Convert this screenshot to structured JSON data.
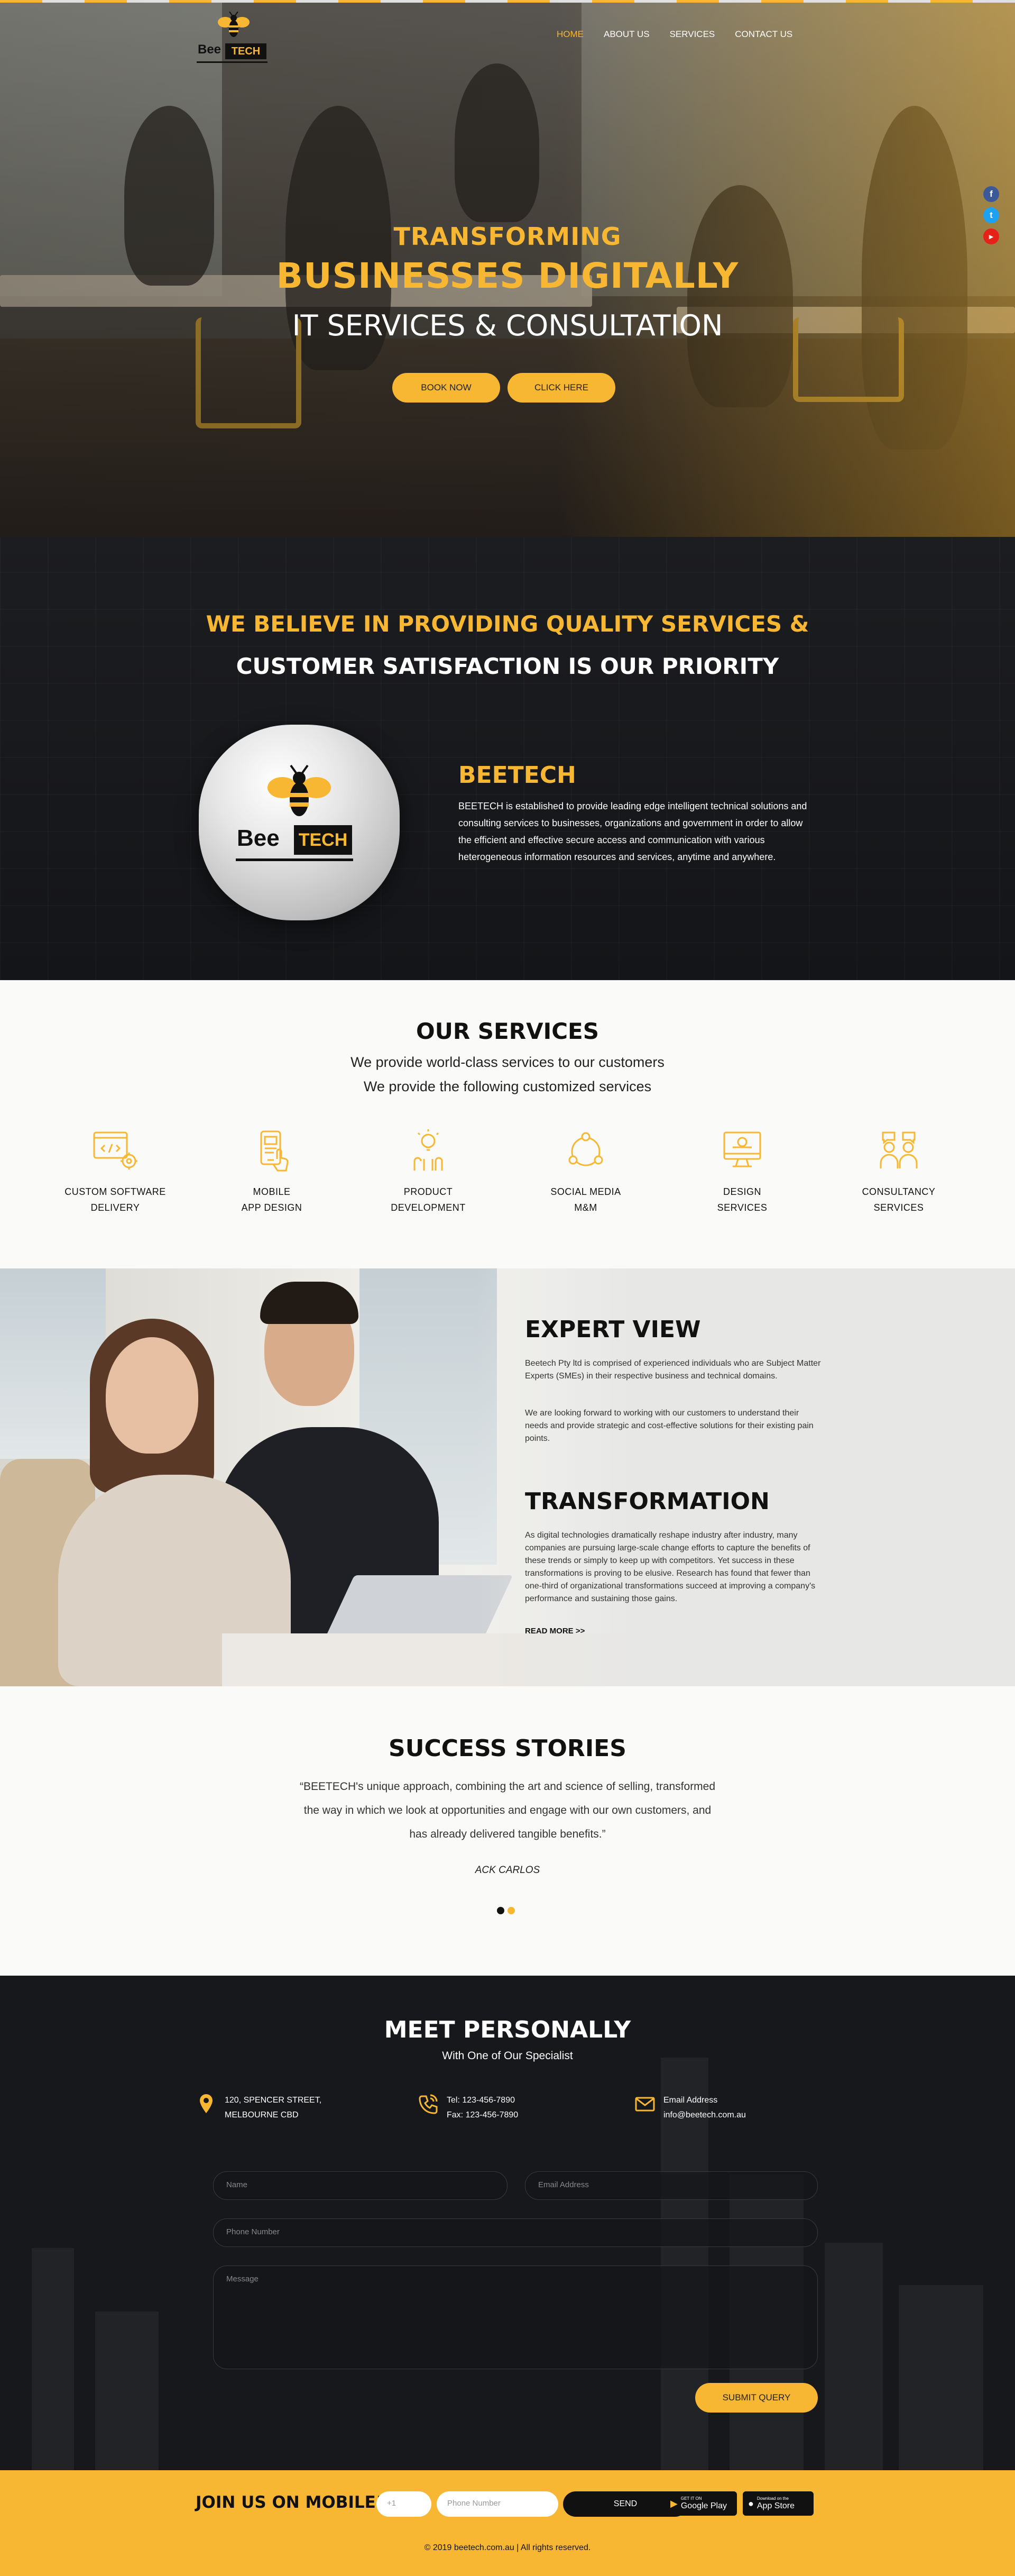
{
  "brand": {
    "name_left": "Bee",
    "name_right": "TECH"
  },
  "nav": {
    "items": [
      {
        "label": "HOME",
        "active": true
      },
      {
        "label": "ABOUT US",
        "active": false
      },
      {
        "label": "SERVICES",
        "active": false
      },
      {
        "label": "CONTACT US",
        "active": false
      }
    ]
  },
  "social": [
    {
      "icon": "facebook-icon",
      "glyph": "f",
      "color": "#3b5998"
    },
    {
      "icon": "twitter-icon",
      "glyph": "t",
      "color": "#1da1f2"
    },
    {
      "icon": "youtube-icon",
      "glyph": "▶",
      "color": "#e62117"
    }
  ],
  "hero": {
    "line1": "TRANSFORMING",
    "line2": "BUSINESSES DIGITALLY",
    "line3": "IT SERVICES & CONSULTATION",
    "button_book": "BOOK NOW",
    "button_click": "CLICK HERE"
  },
  "believe": {
    "heading1": "WE BELIEVE IN PROVIDING QUALITY SERVICES &",
    "heading2": "CUSTOMER SATISFACTION IS OUR PRIORITY",
    "about_title": "BEETECH",
    "about_text": "BEETECH is established to provide leading edge intelligent technical solutions and consulting services to businesses, organizations and government in order to allow the efficient and effective secure access and communication with various heterogeneous information resources and services, anytime and anywhere."
  },
  "services": {
    "title": "OUR SERVICES",
    "subtitle1": "We provide world-class services to our customers",
    "subtitle2": "We provide the following customized services",
    "items": [
      {
        "line1": "CUSTOM SOFTWARE",
        "line2": "DELIVERY",
        "icon": "software-gear-icon"
      },
      {
        "line1": "MOBILE",
        "line2": "APP DESIGN",
        "icon": "mobile-touch-icon"
      },
      {
        "line1": "PRODUCT",
        "line2": "DEVELOPMENT",
        "icon": "product-bulb-icon"
      },
      {
        "line1": "SOCIAL MEDIA",
        "line2": "M&M",
        "icon": "social-network-icon"
      },
      {
        "line1": "DESIGN",
        "line2": "SERVICES",
        "icon": "design-monitor-icon"
      },
      {
        "line1": "CONSULTANCY",
        "line2": "SERVICES",
        "icon": "consultancy-people-icon"
      }
    ]
  },
  "expert": {
    "title": "EXPERT VIEW",
    "para1": "Beetech Pty ltd is comprised of experienced individuals who are Subject Matter Experts (SMEs) in their respective business and technical domains.",
    "para2": "We are looking forward to working with our customers to understand their needs and provide strategic and cost-effective solutions for their existing pain points.",
    "title2": "TRANSFORMATION",
    "para3": "As digital technologies dramatically reshape industry after industry, many companies are pursuing large-scale change efforts to capture the benefits of these trends or simply to keep up with competitors. Yet success in these transformations is proving to be elusive. Research has found that fewer than one-third of organizational transformations succeed at improving a company's performance and sustaining those gains.",
    "read_more": "READ MORE >>"
  },
  "success": {
    "title": "SUCCESS STORIES",
    "quote": "“BEETECH's unique approach, combining the art and science of selling, transformed the way in which we look at opportunities and engage with our own customers, and has already delivered tangible benefits.”",
    "author": "ACK CARLOS",
    "dot_colors": [
      "#111111",
      "#f7b733"
    ]
  },
  "contact": {
    "title": "MEET PERSONALLY",
    "subtitle": "With One of Our Specialist",
    "address1": "120, SPENCER STREET,",
    "address2": "MELBOURNE CBD",
    "tel": "Tel: 123-456-7890",
    "fax": "Fax: 123-456-7890",
    "email_label": "Email Address",
    "email": "info@beetech.com.au",
    "form": {
      "name_placeholder": "Name",
      "email_placeholder": "Email Address",
      "phone_placeholder": "Phone Number",
      "message_placeholder": "Message",
      "submit": "SUBMIT QUERY"
    }
  },
  "footer": {
    "join": "JOIN US ON MOBILE!",
    "country_code": "+1",
    "phone_placeholder": "Phone Number",
    "send": "SEND",
    "google_small": "GET IT ON",
    "google_big": "Google Play",
    "apple_small": "Download on the",
    "apple_big": "App Store",
    "copyright": "© 2019 beetech.com.au | All rights reserved."
  },
  "colors": {
    "accent": "#f7b733",
    "dark": "#17181b"
  }
}
